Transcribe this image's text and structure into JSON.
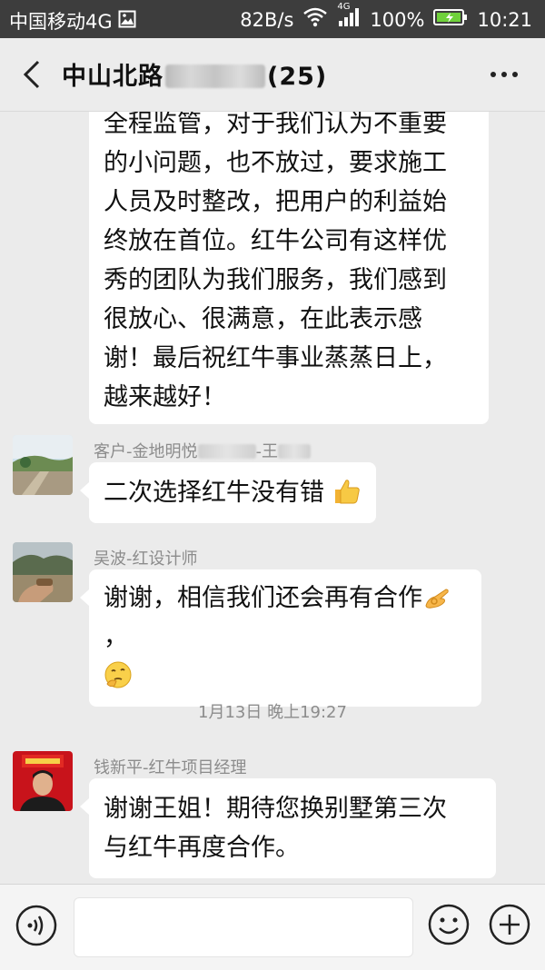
{
  "status_bar": {
    "carrier": "中国移动4G",
    "speed": "82B/s",
    "network": "4G",
    "battery": "100%",
    "time": "10:21"
  },
  "header": {
    "title": "中山北路",
    "count": "(25)"
  },
  "messages": [
    {
      "text": "全程监管，对于我们认为不重要的小问题，也不放过，要求施工人员及时整改，把用户的利益始终放在首位。红牛公司有这样优秀的团队为我们服务，我们感到很放心、很满意，在此表示感谢！最后祝红牛事业蒸蒸日上，越来越好！",
      "lines": [
        "全程监管，对于我们认为不重要",
        "的小问题，也不放过，要求施工",
        "人员及时整改，把用户的利益始",
        "终放在首位。红牛公司有这样优",
        "秀的团队为我们服务，我们感到",
        "很放心、很满意，在此表示感",
        "谢！最后祝红牛事业蒸蒸日上，",
        "越来越好！"
      ]
    },
    {
      "sender_prefix": "客户-金地明悦",
      "sender_suffix": "-王",
      "text": "二次选择红牛没有错",
      "emoji": "thumbs-up"
    },
    {
      "sender": "吴波-红设计师",
      "text_line1": "谢谢，相信我们还会再有合作",
      "text_line1_tail": "，",
      "emoji_line1": "ok-hand",
      "emoji_line2": "thinking-face"
    },
    {
      "sender": "钱新平-红牛项目经理",
      "text_lines": [
        "谢谢王姐！期待您换别墅第三次",
        "与红牛再度合作。"
      ]
    }
  ],
  "timestamp": "1月13日 晚上19:27",
  "colors": {
    "status_bar_bg": "#3d3d3d",
    "chat_bg": "#ebebeb",
    "bubble_bg": "#ffffff",
    "battery_fill": "#6fd13b"
  }
}
